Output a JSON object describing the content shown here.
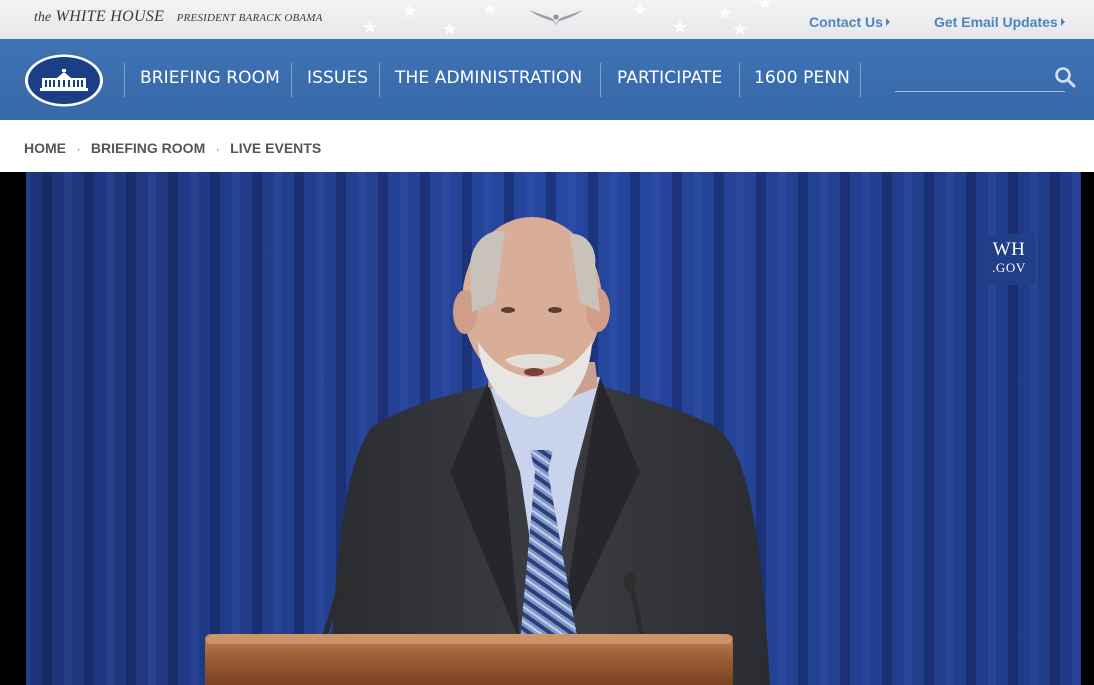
{
  "brand": {
    "the": "the",
    "white_house": "WHITE HOUSE",
    "president": "PRESIDENT BARACK OBAMA"
  },
  "top_links": {
    "contact": "Contact Us",
    "email": "Get Email Updates"
  },
  "nav": {
    "items": [
      {
        "label": "BRIEFING ROOM"
      },
      {
        "label": "ISSUES"
      },
      {
        "label": "THE ADMINISTRATION"
      },
      {
        "label": "PARTICIPATE"
      },
      {
        "label": "1600 PENN"
      }
    ],
    "search": {
      "placeholder": "",
      "icon": "search-icon"
    }
  },
  "breadcrumb": {
    "home": "HOME",
    "briefing_room": "BRIEFING ROOM",
    "live_events": "LIVE EVENTS",
    "separator": "·"
  },
  "video": {
    "badge_line1": "WH",
    "badge_line2": ".GOV"
  },
  "colors": {
    "nav_blue": "#3f73b4",
    "link_blue": "#4d84c0",
    "badge_blue": "#1f3f88",
    "curtain_blue": "#23409a"
  }
}
